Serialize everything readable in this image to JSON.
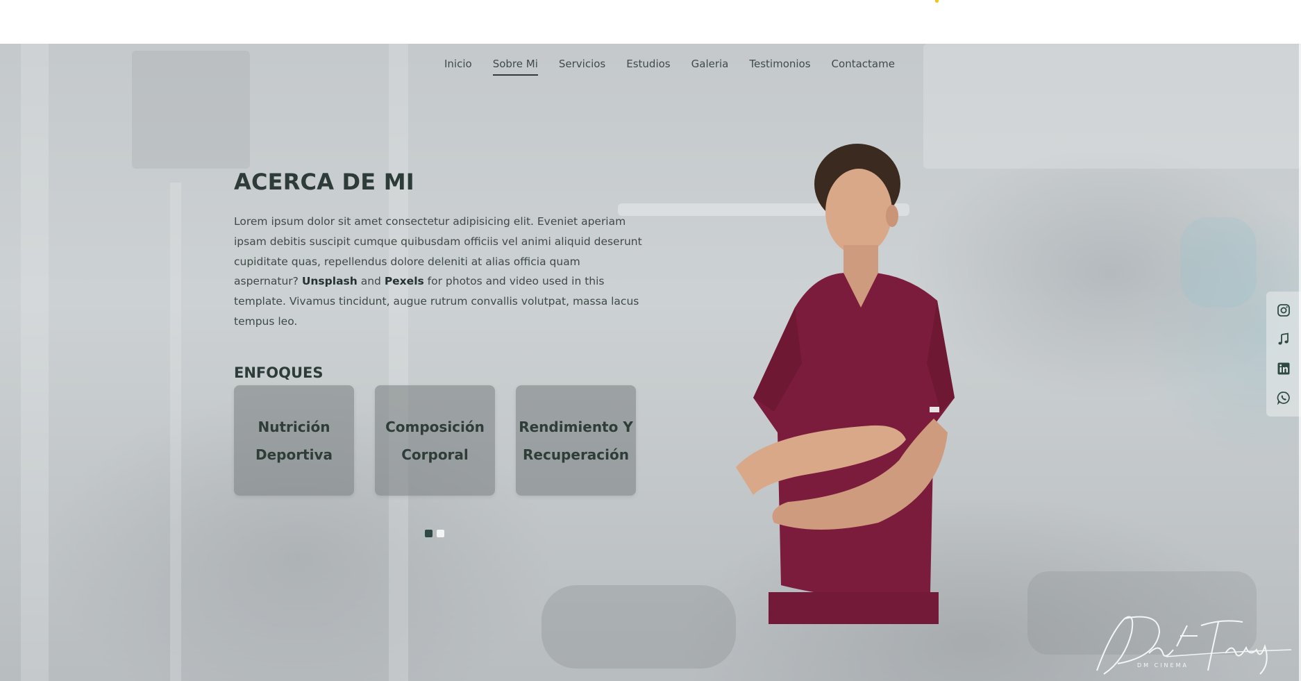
{
  "nav": {
    "items": [
      {
        "label": "Inicio",
        "active": false
      },
      {
        "label": "Sobre Mi",
        "active": true
      },
      {
        "label": "Servicios",
        "active": false
      },
      {
        "label": "Estudios",
        "active": false
      },
      {
        "label": "Galeria",
        "active": false
      },
      {
        "label": "Testimonios",
        "active": false
      },
      {
        "label": "Contactame",
        "active": false
      }
    ]
  },
  "about": {
    "title": "ACERCA DE MI",
    "text_1": "Lorem ipsum dolor sit amet consectetur adipisicing elit. Eveniet aperiam ipsam debitis suscipit cumque quibusdam officiis vel animi aliquid deserunt cupiditate quas, repellendus dolore deleniti at alias officia quam aspernatur? ",
    "bold_1": "Unsplash",
    "text_2": " and ",
    "bold_2": "Pexels",
    "text_3": " for photos and video used in this template. Vivamus tincidunt, augue rutrum convallis volutpat, massa lacus tempus leo."
  },
  "focus": {
    "title": "ENFOQUES",
    "cards": [
      {
        "line1": "Nutrición",
        "line2": "Deportiva"
      },
      {
        "line1": "Composición",
        "line2": "Corporal"
      },
      {
        "line1": "Rendimiento Y",
        "line2": "Recuperación"
      }
    ]
  },
  "carousel": {
    "pages": 2,
    "current": 1
  },
  "social": {
    "icons": [
      "instagram-icon",
      "tiktok-icon",
      "linkedin-icon",
      "whatsapp-icon"
    ]
  },
  "signature": {
    "name": "Dat Truong",
    "sub": "DM CINEMA"
  },
  "colors": {
    "accent": "#2f4a42",
    "scrubs": "#7b1c3c",
    "heading": "#2d3c38"
  }
}
